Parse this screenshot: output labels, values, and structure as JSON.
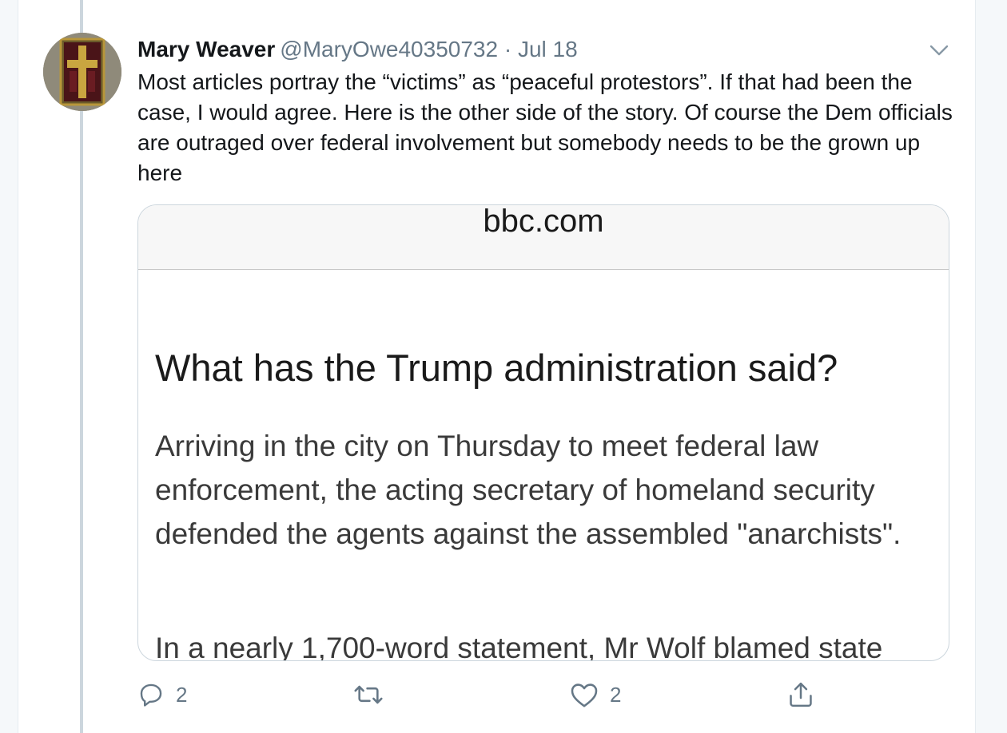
{
  "tweet": {
    "author_name": "Mary Weaver",
    "author_handle": "@MaryOwe40350732",
    "separator": "·",
    "date": "Jul 18",
    "text": "Most articles portray the “victims” as “peaceful protestors”. If that had been the case, I would agree. Here is the other side of the story. Of course the Dem officials are outraged over federal involvement but somebody needs to be the grown up here"
  },
  "media": {
    "domain": "bbc.com",
    "heading": "What has the Trump administration said?",
    "paragraph1": "Arriving in the city on Thursday to meet federal law enforcement, the acting secretary of homeland security defended the agents against the assembled \"anarchists\".",
    "paragraph2": "In a nearly 1,700-word statement, Mr Wolf blamed state"
  },
  "actions": {
    "reply_count": "2",
    "like_count": "2"
  },
  "icons": {
    "menu": "chevron-down-icon",
    "reply": "reply-icon",
    "retweet": "retweet-icon",
    "like": "heart-icon",
    "share": "share-icon"
  },
  "colors": {
    "secondary_text": "#657786",
    "thread_line": "#ccd6dd",
    "border": "#e6ecf0"
  }
}
